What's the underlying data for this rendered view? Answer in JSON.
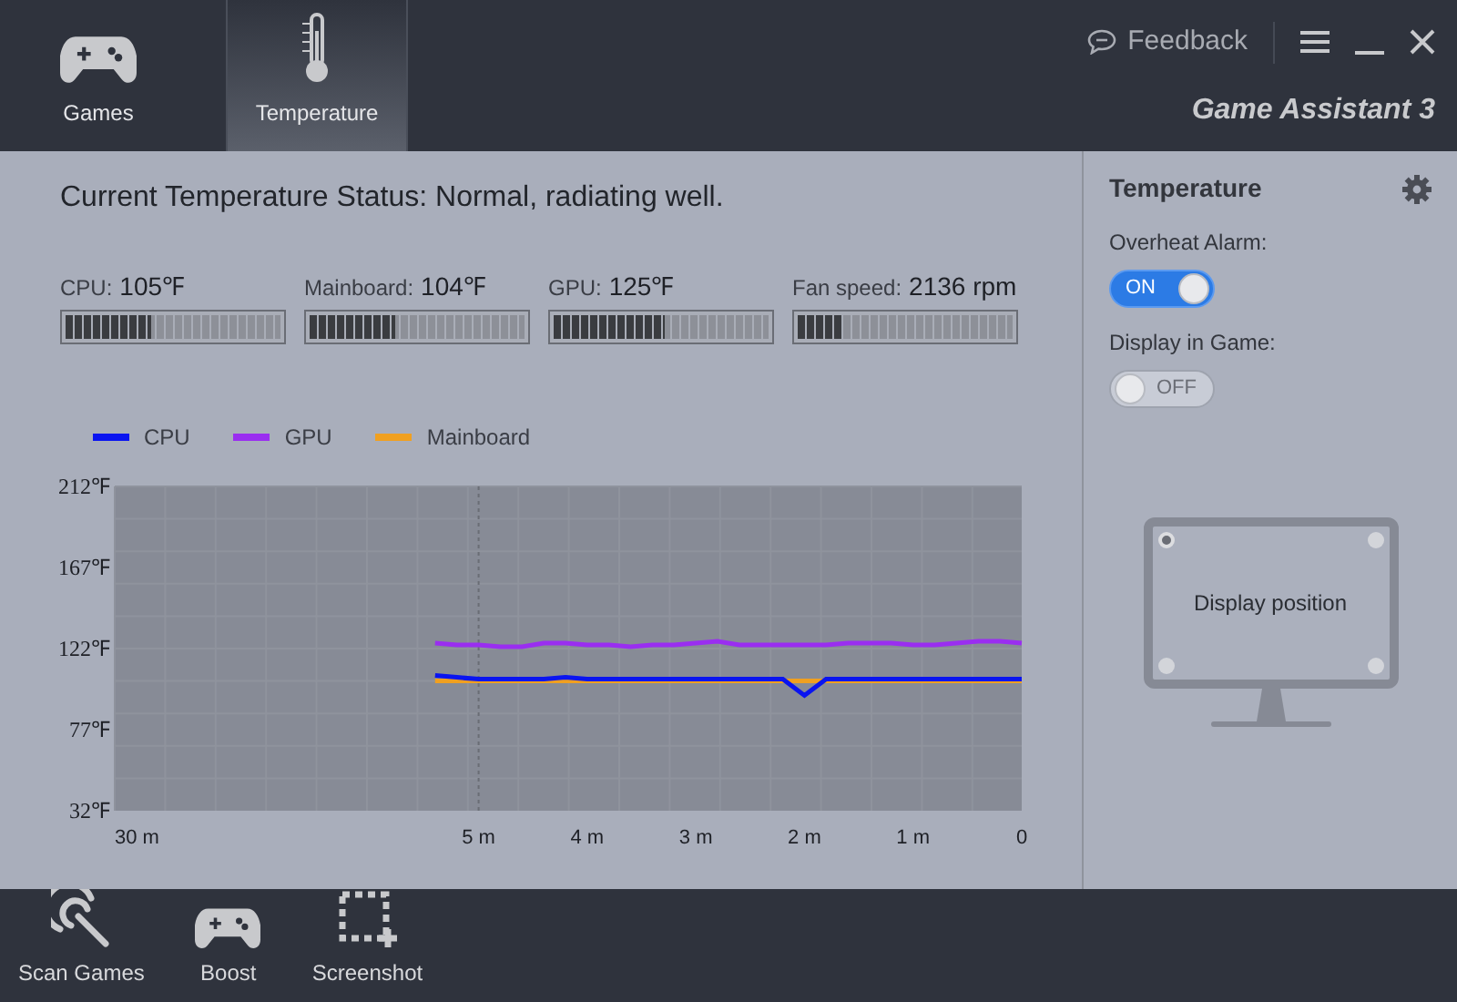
{
  "nav_tabs": [
    {
      "label": "Games",
      "kind": "gamepad",
      "selected": false
    },
    {
      "label": "Temperature",
      "kind": "thermometer",
      "selected": true
    }
  ],
  "feedback": "Feedback",
  "app_title": "Game Assistant 3",
  "status": "Current Temperature Status: Normal, radiating well.",
  "readings": [
    {
      "label": "CPU:",
      "value": "105℉",
      "level": 0.4
    },
    {
      "label": "Mainboard:",
      "value": "104℉",
      "level": 0.4
    },
    {
      "label": "GPU:",
      "value": "125℉",
      "level": 0.52
    },
    {
      "label": "Fan speed:",
      "value": "2136 rpm",
      "level": 0.2
    }
  ],
  "chart_data": {
    "type": "line",
    "x": [
      -5.4,
      -5.2,
      -5.0,
      -4.8,
      -4.6,
      -4.4,
      -4.2,
      -4.0,
      -3.8,
      -3.6,
      -3.4,
      -3.2,
      -3.0,
      -2.8,
      -2.6,
      -2.4,
      -2.2,
      -2.0,
      -1.8,
      -1.6,
      -1.4,
      -1.2,
      -1.0,
      -0.8,
      -0.6,
      -0.4,
      -0.2,
      0
    ],
    "series": [
      {
        "name": "CPU",
        "color": "#0a14f0",
        "values": [
          107,
          106,
          105,
          105,
          105,
          105,
          106,
          105,
          105,
          105,
          105,
          105,
          105,
          105,
          105,
          105,
          105,
          96,
          105,
          105,
          105,
          105,
          105,
          105,
          105,
          105,
          105,
          105
        ]
      },
      {
        "name": "GPU",
        "color": "#9a2ef0",
        "values": [
          125,
          124,
          124,
          123,
          123,
          125,
          125,
          124,
          124,
          123,
          124,
          124,
          125,
          126,
          124,
          124,
          124,
          124,
          124,
          125,
          125,
          125,
          124,
          124,
          125,
          126,
          126,
          125
        ]
      },
      {
        "name": "Mainboard",
        "color": "#f0a020",
        "values": [
          104,
          104,
          104,
          104,
          104,
          104,
          104,
          104,
          104,
          104,
          104,
          104,
          104,
          104,
          104,
          104,
          104,
          104,
          104,
          104,
          104,
          104,
          104,
          104,
          104,
          104,
          104,
          104
        ]
      }
    ],
    "ylim": [
      32,
      212
    ],
    "yticks": [
      {
        "value": 212,
        "label": "212℉"
      },
      {
        "value": 167,
        "label": "167℉"
      },
      {
        "value": 122,
        "label": "122℉"
      },
      {
        "value": 77,
        "label": "77℉"
      },
      {
        "value": 32,
        "label": "32℉"
      }
    ],
    "xlim": [
      -8.35,
      0
    ],
    "xticks": [
      {
        "value": -5,
        "label": "5 m"
      },
      {
        "value": -4,
        "label": "4 m"
      },
      {
        "value": -3,
        "label": "3 m"
      },
      {
        "value": -2,
        "label": "2 m"
      },
      {
        "value": -1,
        "label": "1 m"
      },
      {
        "value": 0,
        "label": "0"
      }
    ],
    "legend": true,
    "ref_lines": [
      {
        "axis": "x",
        "value": -5
      }
    ]
  },
  "chart_axis_start_label": "30 m",
  "side_panel": {
    "title": "Temperature",
    "toggles": [
      {
        "label": "Overheat Alarm:",
        "state": "ON",
        "on": true
      },
      {
        "label": "Display in Game:",
        "state": "OFF",
        "on": false
      }
    ],
    "display_position": {
      "label": "Display position",
      "corners": [
        {
          "selected": true
        },
        {
          "selected": false
        },
        {
          "selected": false
        },
        {
          "selected": false
        }
      ]
    }
  },
  "bottom_tools": [
    {
      "label": "Scan Games",
      "kind": "scan"
    },
    {
      "label": "Boost",
      "kind": "gamepad"
    },
    {
      "label": "Screenshot",
      "kind": "screenshot"
    }
  ]
}
